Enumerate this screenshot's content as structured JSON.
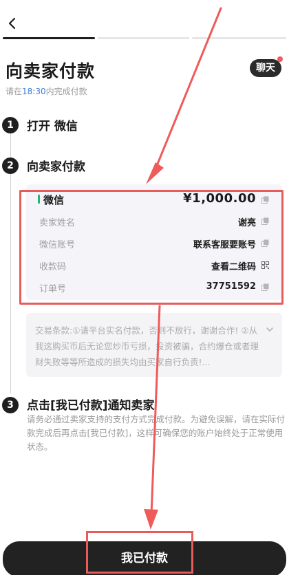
{
  "header": {
    "title": "向卖家付款",
    "chat_label": "聊天"
  },
  "deadline": {
    "prefix": "请在",
    "time": "18:30",
    "suffix": "内完成付款"
  },
  "steps": [
    {
      "number": "1",
      "title": "打开 微信"
    },
    {
      "number": "2",
      "title": "向卖家付款"
    },
    {
      "number": "3",
      "title": "点击[我已付款]通知卖家"
    }
  ],
  "payment": {
    "method": "微信",
    "amount": "¥1,000.00",
    "rows": [
      {
        "label": "卖家姓名",
        "value": "谢亮"
      },
      {
        "label": "微信账号",
        "value": "联系客服要账号"
      },
      {
        "label": "收款码",
        "value": "查看二维码"
      },
      {
        "label": "订单号",
        "value": "37751592"
      }
    ]
  },
  "terms": {
    "text": "交易条款:①请平台实名付款，否则不放行，谢谢合作! ②从我这购买币后无论您炒币亏损，投资被骗，合约爆仓或者理财失败等等所造成的损失均由买家自行负责!..."
  },
  "step3_description": "请务必通过卖家支持的支付方式完成付款。为避免误解，请在实际付款完成后再点击[我已付款]，这样可确保您的账户始终处于正常使用状态。",
  "confirm_button": "我已付款",
  "colors": {
    "accent": "#3a7bd5",
    "wechat": "#22b573",
    "highlight": "#e85b5b",
    "dark": "#222222"
  },
  "icons": [
    "back-arrow-icon",
    "copy-icon",
    "qr-code-icon",
    "chevron-down-icon"
  ]
}
